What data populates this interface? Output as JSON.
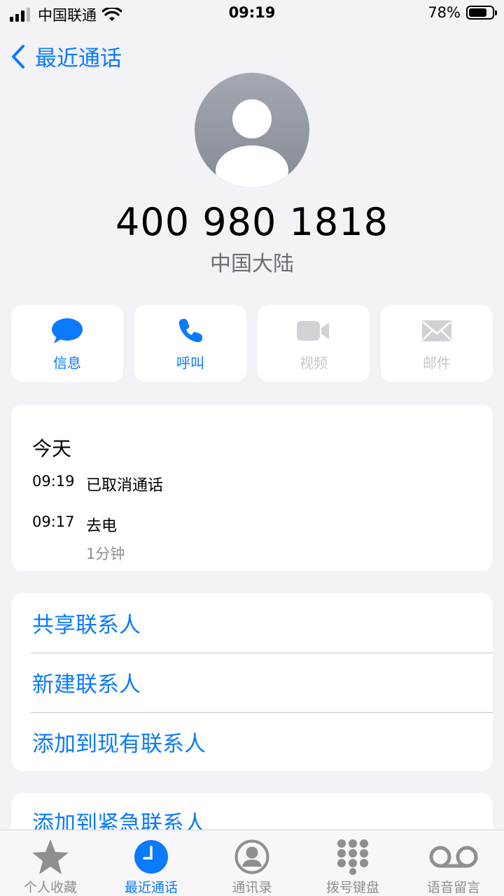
{
  "status_bar": {
    "carrier": "中国联通",
    "time": "09:19",
    "battery": "78%",
    "battery_level": 0.78,
    "icons": [
      "signal-icon",
      "wifi-icon",
      "battery-icon"
    ]
  },
  "nav": {
    "back_label": "最近通话"
  },
  "contact": {
    "number": "400 980 1818",
    "region": "中国大陆"
  },
  "actions": [
    {
      "label": "信息",
      "icon": "message-icon",
      "enabled": true
    },
    {
      "label": "呼叫",
      "icon": "phone-icon",
      "enabled": true
    },
    {
      "label": "视频",
      "icon": "video-icon",
      "enabled": false
    },
    {
      "label": "邮件",
      "icon": "mail-icon",
      "enabled": false
    }
  ],
  "recent_calls": {
    "day": "今天",
    "items": [
      {
        "time": "09:19",
        "type": "已取消通话",
        "duration": ""
      },
      {
        "time": "09:17",
        "type": "去电",
        "duration": "1分钟"
      }
    ]
  },
  "options": [
    {
      "label": "共享联系人"
    },
    {
      "label": "新建联系人"
    },
    {
      "label": "添加到现有联系人"
    },
    {
      "label": "添加到紧急联系人"
    }
  ],
  "tab_bar": {
    "items": [
      {
        "label": "个人收藏",
        "icon": "star-icon",
        "active": false
      },
      {
        "label": "最近通话",
        "icon": "clock-icon",
        "active": true
      },
      {
        "label": "通讯录",
        "icon": "contacts-icon",
        "active": false
      },
      {
        "label": "拨号键盘",
        "icon": "keypad-icon",
        "active": false
      },
      {
        "label": "语音留言",
        "icon": "voicemail-icon",
        "active": false
      }
    ]
  },
  "colors": {
    "accent": "#0a7aff",
    "background": "#f2f2f7",
    "disabled": "#c7c7cc",
    "secondary_text": "#8e8e93"
  }
}
